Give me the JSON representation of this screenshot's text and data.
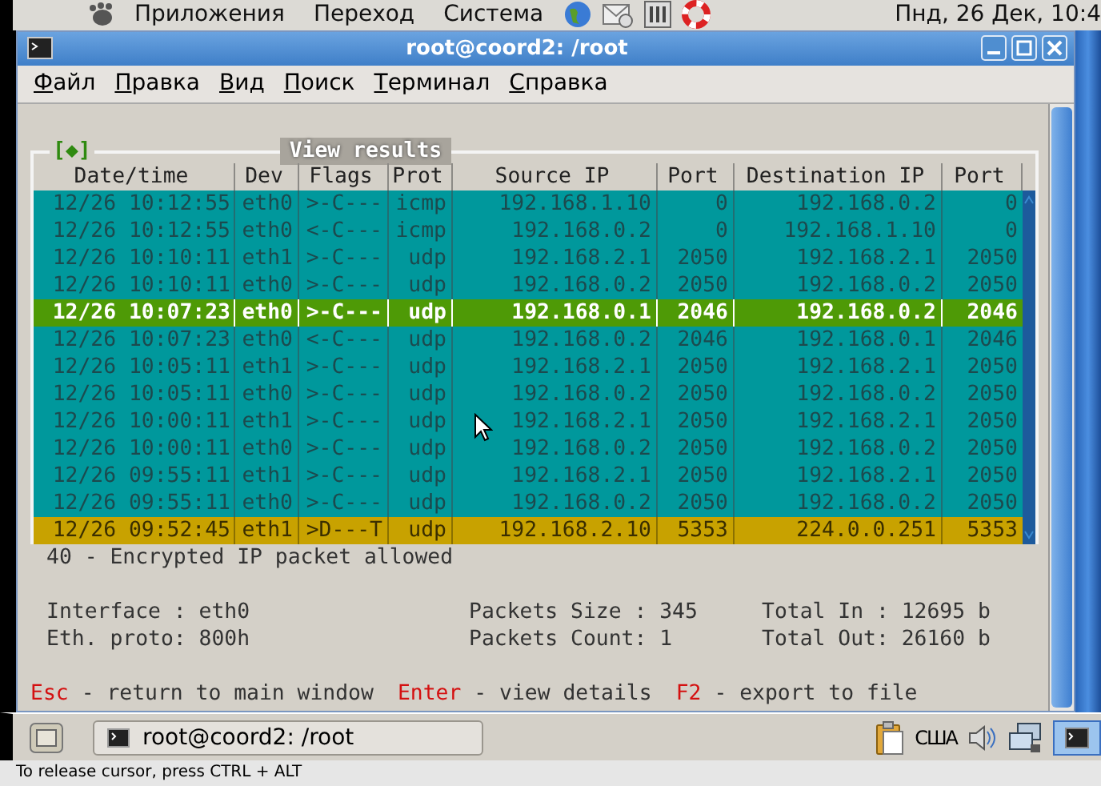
{
  "top_panel": {
    "menus": [
      "Приложения",
      "Переход",
      "Система"
    ],
    "clock": "Пнд, 26 Дек, 10:4"
  },
  "window": {
    "title": "root@coord2: /root"
  },
  "menu_bar": [
    "Файл",
    "Правка",
    "Вид",
    "Поиск",
    "Терминал",
    "Справка"
  ],
  "results": {
    "frame_marker": "[◆]",
    "title": "View results",
    "columns": [
      "Date/time",
      "Dev",
      "Flags",
      "Prot",
      "Source IP",
      "Port",
      "Destination IP",
      "Port"
    ],
    "rows": [
      {
        "kind": "normal",
        "selected": false,
        "cells": [
          "12/26 10:12:55",
          "eth0",
          ">-C---",
          "icmp",
          "192.168.1.10",
          "0",
          "192.168.0.2",
          "0"
        ]
      },
      {
        "kind": "normal",
        "selected": false,
        "cells": [
          "12/26 10:12:55",
          "eth0",
          "<-C---",
          "icmp",
          "192.168.0.2",
          "0",
          "192.168.1.10",
          "0"
        ]
      },
      {
        "kind": "normal",
        "selected": false,
        "cells": [
          "12/26 10:10:11",
          "eth1",
          ">-C---",
          "udp",
          "192.168.2.1",
          "2050",
          "192.168.2.1",
          "2050"
        ]
      },
      {
        "kind": "normal",
        "selected": false,
        "cells": [
          "12/26 10:10:11",
          "eth0",
          ">-C---",
          "udp",
          "192.168.0.2",
          "2050",
          "192.168.0.2",
          "2050"
        ]
      },
      {
        "kind": "normal",
        "selected": true,
        "cells": [
          "12/26 10:07:23",
          "eth0",
          ">-C---",
          "udp",
          "192.168.0.1",
          "2046",
          "192.168.0.2",
          "2046"
        ]
      },
      {
        "kind": "normal",
        "selected": false,
        "cells": [
          "12/26 10:07:23",
          "eth0",
          "<-C---",
          "udp",
          "192.168.0.2",
          "2046",
          "192.168.0.1",
          "2046"
        ]
      },
      {
        "kind": "normal",
        "selected": false,
        "cells": [
          "12/26 10:05:11",
          "eth1",
          ">-C---",
          "udp",
          "192.168.2.1",
          "2050",
          "192.168.2.1",
          "2050"
        ]
      },
      {
        "kind": "normal",
        "selected": false,
        "cells": [
          "12/26 10:05:11",
          "eth0",
          ">-C---",
          "udp",
          "192.168.0.2",
          "2050",
          "192.168.0.2",
          "2050"
        ]
      },
      {
        "kind": "normal",
        "selected": false,
        "cells": [
          "12/26 10:00:11",
          "eth1",
          ">-C---",
          "udp",
          "192.168.2.1",
          "2050",
          "192.168.2.1",
          "2050"
        ]
      },
      {
        "kind": "normal",
        "selected": false,
        "cells": [
          "12/26 10:00:11",
          "eth0",
          ">-C---",
          "udp",
          "192.168.0.2",
          "2050",
          "192.168.0.2",
          "2050"
        ]
      },
      {
        "kind": "normal",
        "selected": false,
        "cells": [
          "12/26 09:55:11",
          "eth1",
          ">-C---",
          "udp",
          "192.168.2.1",
          "2050",
          "192.168.2.1",
          "2050"
        ]
      },
      {
        "kind": "normal",
        "selected": false,
        "cells": [
          "12/26 09:55:11",
          "eth0",
          ">-C---",
          "udp",
          "192.168.0.2",
          "2050",
          "192.168.0.2",
          "2050"
        ]
      },
      {
        "kind": "marked",
        "selected": false,
        "cells": [
          "12/26 09:52:45",
          "eth1",
          ">D---T",
          "udp",
          "192.168.2.10",
          "5353",
          "224.0.0.251",
          "5353"
        ]
      }
    ]
  },
  "event_description": "40 - Encrypted IP packet allowed",
  "details": [
    [
      "Interface : eth0",
      "Eth. proto: 800h"
    ],
    [
      "Packets Size : 345",
      "Packets Count: 1"
    ],
    [
      "Total In : 12695 b",
      "Total Out: 26160 b"
    ]
  ],
  "hotkeys": [
    {
      "key": "Esc",
      "action": "- return to main window"
    },
    {
      "key": "Enter",
      "action": "- view details"
    },
    {
      "key": "F2",
      "action": "- export to file"
    }
  ],
  "taskbar": {
    "task": "root@coord2: /root",
    "keyboard_layout": "США"
  },
  "status_bar": "To release cursor, press CTRL + ALT"
}
